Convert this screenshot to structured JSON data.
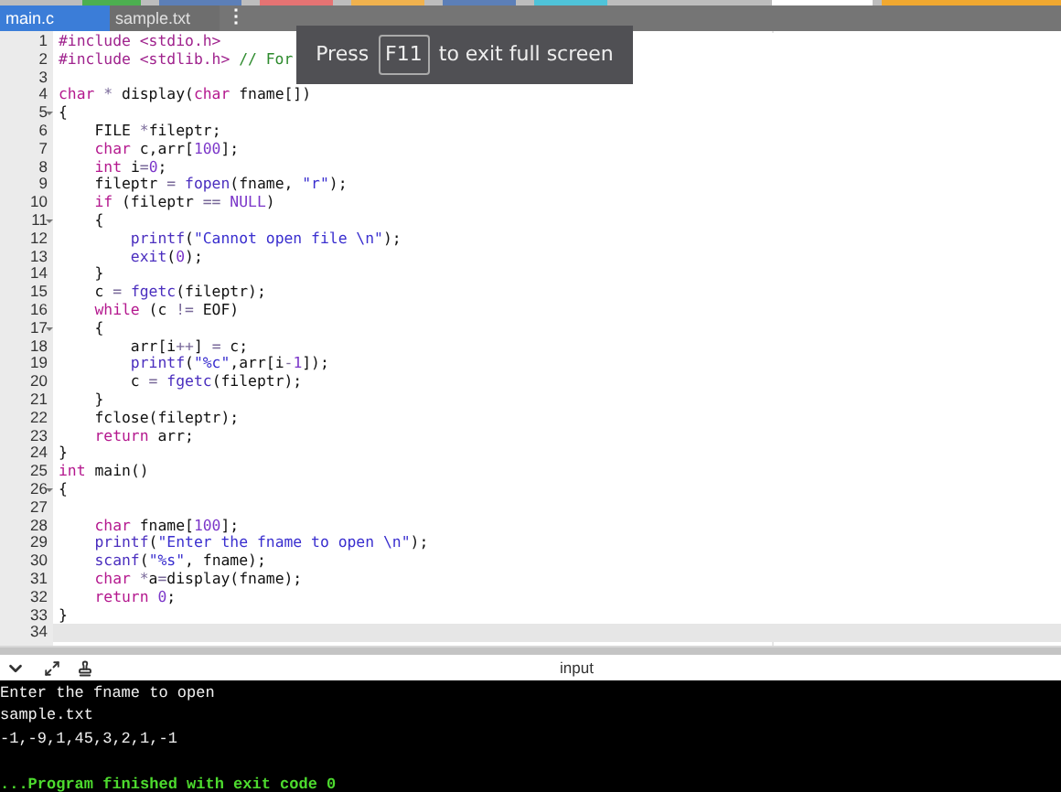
{
  "tabs": [
    {
      "label": "main.c",
      "selected": true
    },
    {
      "label": "sample.txt",
      "selected": false
    }
  ],
  "tab_menu": "⋮",
  "fullscreen_notice": {
    "before": "Press",
    "key": "F11",
    "after": "to exit full screen"
  },
  "editor": {
    "lines": [
      {
        "num": "1",
        "fold": false,
        "current": false,
        "segs": [
          {
            "kind": "pp",
            "text": "#include <stdio.h>"
          }
        ]
      },
      {
        "num": "2",
        "fold": false,
        "current": false,
        "segs": [
          {
            "kind": "pp",
            "text": "#include <stdlib.h> "
          },
          {
            "kind": "comment",
            "text": "// For"
          }
        ]
      },
      {
        "num": "3",
        "fold": false,
        "current": false
      },
      {
        "num": "4",
        "fold": false,
        "current": false,
        "segs": [
          {
            "kind": "kw",
            "text": "char"
          },
          {
            "kind": "op",
            "text": " * "
          },
          {
            "kind": "plain",
            "text": "display("
          },
          {
            "kind": "kw",
            "text": "char"
          },
          {
            "kind": "plain",
            "text": " fname[])"
          }
        ]
      },
      {
        "num": "5",
        "fold": true,
        "current": false,
        "segs": [
          {
            "kind": "plain",
            "text": "{"
          }
        ]
      },
      {
        "num": "6",
        "fold": false,
        "current": false,
        "segs": [
          {
            "kind": "plain",
            "text": "    FILE "
          },
          {
            "kind": "op",
            "text": "*"
          },
          {
            "kind": "plain",
            "text": "fileptr;"
          }
        ]
      },
      {
        "num": "7",
        "fold": false,
        "current": false,
        "segs": [
          {
            "kind": "kw",
            "text": "    char"
          },
          {
            "kind": "plain",
            "text": " c,arr["
          },
          {
            "kind": "num",
            "text": "100"
          },
          {
            "kind": "plain",
            "text": "];"
          }
        ]
      },
      {
        "num": "8",
        "fold": false,
        "current": false,
        "segs": [
          {
            "kind": "kw",
            "text": "    int"
          },
          {
            "kind": "plain",
            "text": " i"
          },
          {
            "kind": "op",
            "text": "="
          },
          {
            "kind": "num",
            "text": "0"
          },
          {
            "kind": "plain",
            "text": ";"
          }
        ]
      },
      {
        "num": "9",
        "fold": false,
        "current": false,
        "segs": [
          {
            "kind": "plain",
            "text": "    fileptr "
          },
          {
            "kind": "op",
            "text": "="
          },
          {
            "kind": "fn",
            "text": " fopen"
          },
          {
            "kind": "plain",
            "text": "(fname, "
          },
          {
            "kind": "str",
            "text": "\"r\""
          },
          {
            "kind": "plain",
            "text": ");"
          }
        ]
      },
      {
        "num": "10",
        "fold": false,
        "current": false,
        "segs": [
          {
            "kind": "kw",
            "text": "    if"
          },
          {
            "kind": "plain",
            "text": " (fileptr "
          },
          {
            "kind": "op",
            "text": "=="
          },
          {
            "kind": "num",
            "text": " NULL"
          },
          {
            "kind": "plain",
            "text": ")"
          }
        ]
      },
      {
        "num": "11",
        "fold": true,
        "current": false,
        "segs": [
          {
            "kind": "plain",
            "text": "    {"
          }
        ]
      },
      {
        "num": "12",
        "fold": false,
        "current": false,
        "segs": [
          {
            "kind": "fn",
            "text": "        printf"
          },
          {
            "kind": "plain",
            "text": "("
          },
          {
            "kind": "str",
            "text": "\"Cannot open file \\n\""
          },
          {
            "kind": "plain",
            "text": ");"
          }
        ]
      },
      {
        "num": "13",
        "fold": false,
        "current": false,
        "segs": [
          {
            "kind": "fn",
            "text": "        exit"
          },
          {
            "kind": "plain",
            "text": "("
          },
          {
            "kind": "num",
            "text": "0"
          },
          {
            "kind": "plain",
            "text": ");"
          }
        ]
      },
      {
        "num": "14",
        "fold": false,
        "current": false,
        "segs": [
          {
            "kind": "plain",
            "text": "    }"
          }
        ]
      },
      {
        "num": "15",
        "fold": false,
        "current": false,
        "segs": [
          {
            "kind": "plain",
            "text": "    c "
          },
          {
            "kind": "op",
            "text": "="
          },
          {
            "kind": "fn",
            "text": " fgetc"
          },
          {
            "kind": "plain",
            "text": "(fileptr);"
          }
        ]
      },
      {
        "num": "16",
        "fold": false,
        "current": false,
        "segs": [
          {
            "kind": "kw",
            "text": "    while"
          },
          {
            "kind": "plain",
            "text": " (c "
          },
          {
            "kind": "op",
            "text": "!="
          },
          {
            "kind": "plain",
            "text": " EOF)"
          }
        ]
      },
      {
        "num": "17",
        "fold": true,
        "current": false,
        "segs": [
          {
            "kind": "plain",
            "text": "    {"
          }
        ]
      },
      {
        "num": "18",
        "fold": false,
        "current": false,
        "segs": [
          {
            "kind": "plain",
            "text": "        arr[i"
          },
          {
            "kind": "op",
            "text": "++"
          },
          {
            "kind": "plain",
            "text": "] "
          },
          {
            "kind": "op",
            "text": "="
          },
          {
            "kind": "plain",
            "text": " c;"
          }
        ]
      },
      {
        "num": "19",
        "fold": false,
        "current": false,
        "segs": [
          {
            "kind": "fn",
            "text": "        printf"
          },
          {
            "kind": "plain",
            "text": "("
          },
          {
            "kind": "str",
            "text": "\"%c\""
          },
          {
            "kind": "plain",
            "text": ",arr[i"
          },
          {
            "kind": "op",
            "text": "-"
          },
          {
            "kind": "num",
            "text": "1"
          },
          {
            "kind": "plain",
            "text": "]);"
          }
        ]
      },
      {
        "num": "20",
        "fold": false,
        "current": false,
        "segs": [
          {
            "kind": "plain",
            "text": "        c "
          },
          {
            "kind": "op",
            "text": "="
          },
          {
            "kind": "fn",
            "text": " fgetc"
          },
          {
            "kind": "plain",
            "text": "(fileptr);"
          }
        ]
      },
      {
        "num": "21",
        "fold": false,
        "current": false,
        "segs": [
          {
            "kind": "plain",
            "text": "    }"
          }
        ]
      },
      {
        "num": "22",
        "fold": false,
        "current": false,
        "segs": [
          {
            "kind": "plain",
            "text": "    fclose(fileptr);"
          }
        ]
      },
      {
        "num": "23",
        "fold": false,
        "current": false,
        "segs": [
          {
            "kind": "kw",
            "text": "    return"
          },
          {
            "kind": "plain",
            "text": " arr;"
          }
        ]
      },
      {
        "num": "24",
        "fold": false,
        "current": false,
        "segs": [
          {
            "kind": "plain",
            "text": "}"
          }
        ]
      },
      {
        "num": "25",
        "fold": false,
        "current": false,
        "segs": [
          {
            "kind": "kw",
            "text": "int"
          },
          {
            "kind": "plain",
            "text": " main()"
          }
        ]
      },
      {
        "num": "26",
        "fold": true,
        "current": false,
        "segs": [
          {
            "kind": "plain",
            "text": "{"
          }
        ]
      },
      {
        "num": "27",
        "fold": false,
        "current": false
      },
      {
        "num": "28",
        "fold": false,
        "current": false,
        "segs": [
          {
            "kind": "kw",
            "text": "    char"
          },
          {
            "kind": "plain",
            "text": " fname["
          },
          {
            "kind": "num",
            "text": "100"
          },
          {
            "kind": "plain",
            "text": "];"
          }
        ]
      },
      {
        "num": "29",
        "fold": false,
        "current": false,
        "segs": [
          {
            "kind": "fn",
            "text": "    printf"
          },
          {
            "kind": "plain",
            "text": "("
          },
          {
            "kind": "str",
            "text": "\"Enter the fname to open \\n\""
          },
          {
            "kind": "plain",
            "text": ");"
          }
        ]
      },
      {
        "num": "30",
        "fold": false,
        "current": false,
        "segs": [
          {
            "kind": "fn",
            "text": "    scanf"
          },
          {
            "kind": "plain",
            "text": "("
          },
          {
            "kind": "str",
            "text": "\"%s\""
          },
          {
            "kind": "plain",
            "text": ", fname);"
          }
        ]
      },
      {
        "num": "31",
        "fold": false,
        "current": false,
        "segs": [
          {
            "kind": "kw",
            "text": "    char"
          },
          {
            "kind": "op",
            "text": " *"
          },
          {
            "kind": "plain",
            "text": "a"
          },
          {
            "kind": "op",
            "text": "="
          },
          {
            "kind": "plain",
            "text": "display(fname);"
          }
        ]
      },
      {
        "num": "32",
        "fold": false,
        "current": false,
        "segs": [
          {
            "kind": "kw",
            "text": "    return"
          },
          {
            "kind": "num",
            "text": " 0"
          },
          {
            "kind": "plain",
            "text": ";"
          }
        ]
      },
      {
        "num": "33",
        "fold": false,
        "current": false,
        "segs": [
          {
            "kind": "plain",
            "text": "}"
          }
        ]
      },
      {
        "num": "34",
        "fold": false,
        "current": true
      }
    ]
  },
  "console": {
    "title": "input",
    "lines": [
      {
        "kind": "output",
        "text": "Enter the fname to open"
      },
      {
        "kind": "output",
        "text": "sample.txt"
      },
      {
        "kind": "output",
        "text": "-1,-9,1,45,3,2,1,-1"
      },
      {
        "kind": "status",
        "text": "...Program finished with exit code 0"
      }
    ]
  }
}
